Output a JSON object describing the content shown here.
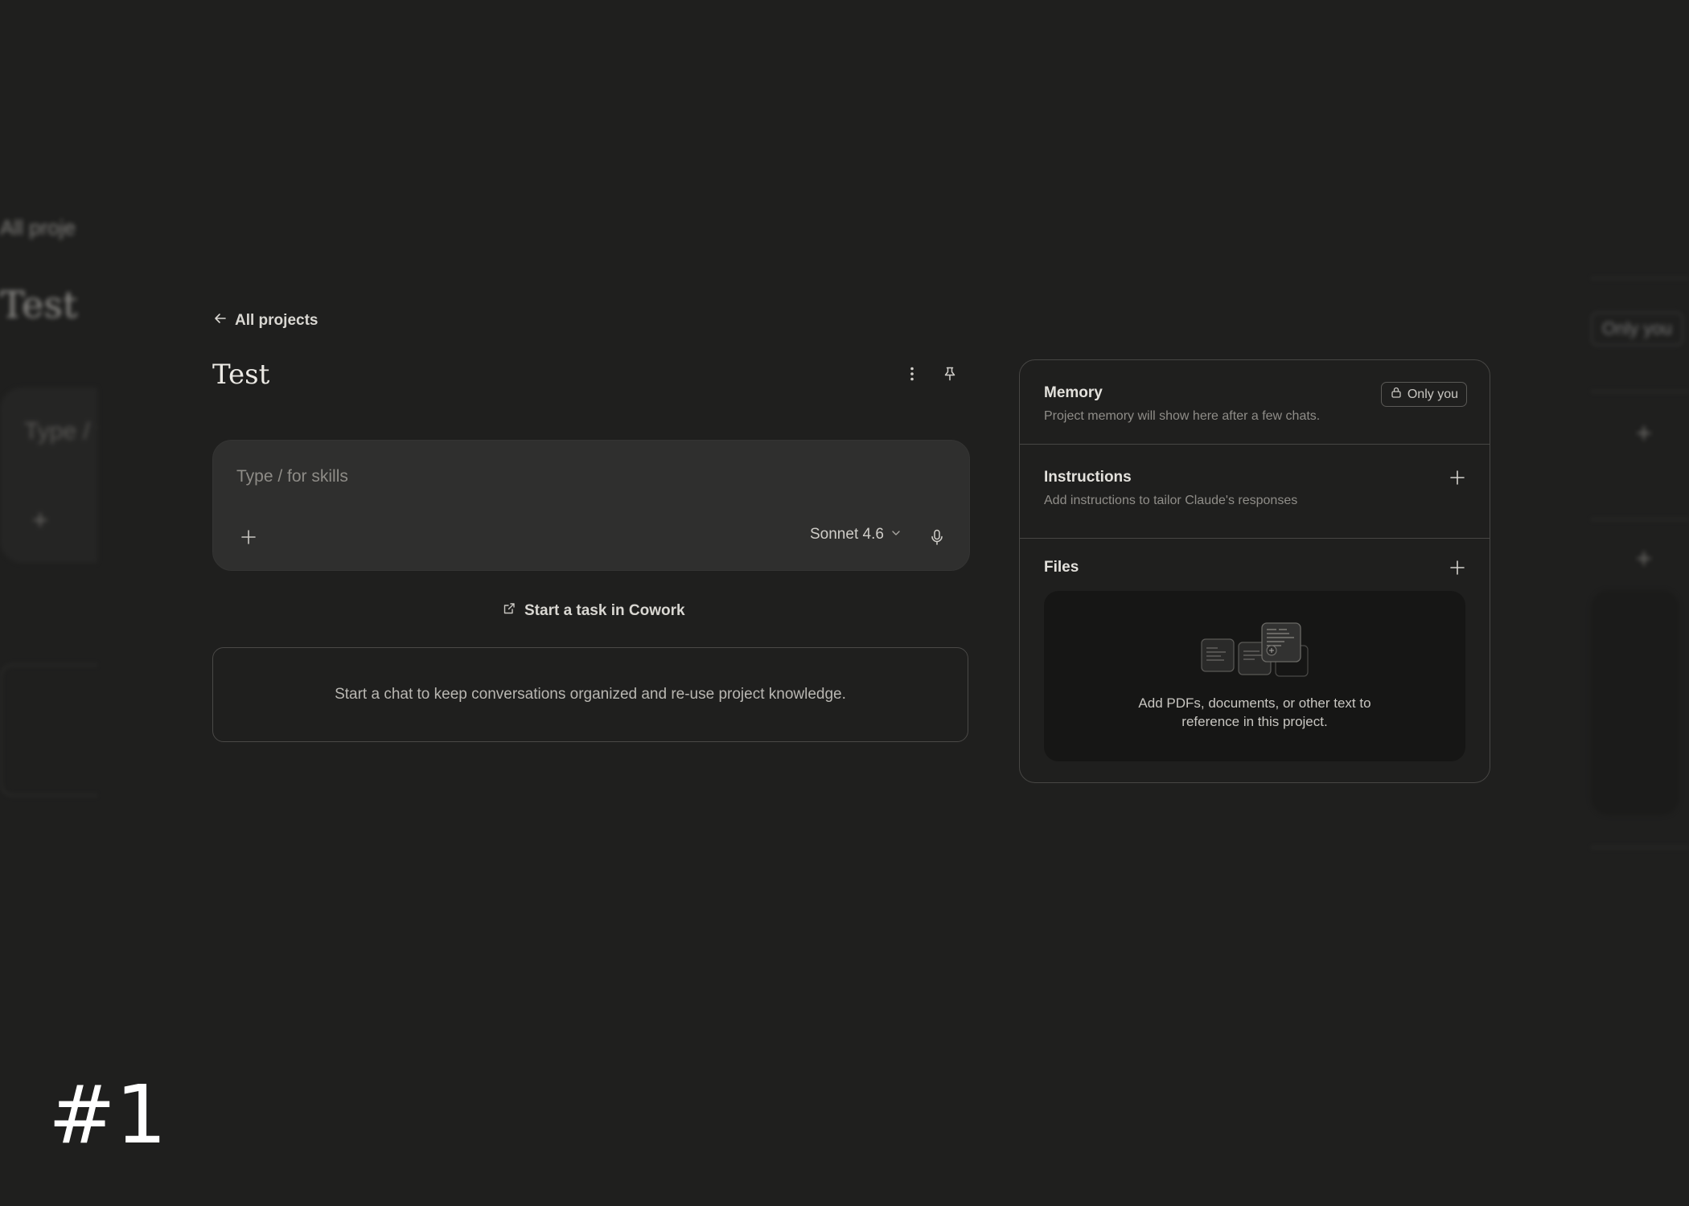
{
  "ghost": {
    "left_back": "All proje",
    "left_title": "Test",
    "left_placeholder": "Type / f",
    "left_plus": "+",
    "right_badge": "Only you",
    "right_plus": "+"
  },
  "nav": {
    "back_label": "All projects"
  },
  "project": {
    "title": "Test"
  },
  "composer": {
    "placeholder": "Type / for skills",
    "model": "Sonnet 4.6"
  },
  "cowork": {
    "label": "Start a task in Cowork"
  },
  "empty_state": {
    "text": "Start a chat to keep conversations organized and re-use project knowledge."
  },
  "panel": {
    "memory": {
      "title": "Memory",
      "description": "Project memory will show here after a few chats.",
      "badge": "Only you"
    },
    "instructions": {
      "title": "Instructions",
      "description": "Add instructions to tailor Claude's responses"
    },
    "files": {
      "title": "Files",
      "drop_line1": "Add PDFs, documents, or other text to",
      "drop_line2": "reference in this project."
    }
  },
  "screen_tag": "#1",
  "icons": {
    "back": "arrow-left-icon",
    "more": "more-vertical-icon",
    "pin": "pin-icon",
    "add": "plus-icon",
    "model_chevron": "chevron-down-icon",
    "mic": "microphone-icon",
    "cowork": "external-link-icon",
    "lock": "lock-icon"
  },
  "colors": {
    "background": "#1f1f1e",
    "composer": "#2f2f2e",
    "dropzone": "#161615",
    "border": "#474644",
    "text": "#e8e6e1",
    "muted": "#8f8d88"
  }
}
